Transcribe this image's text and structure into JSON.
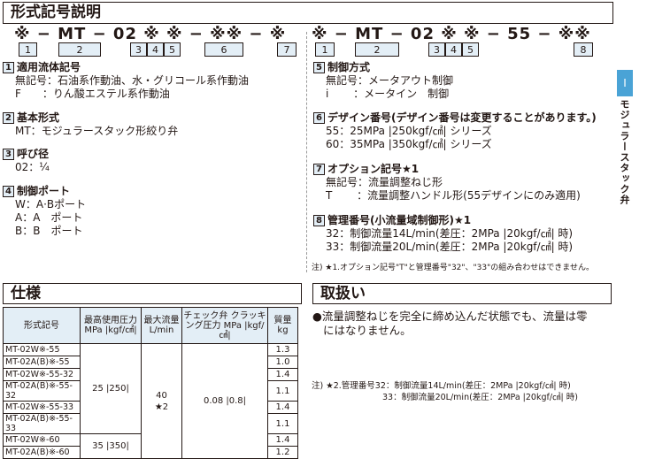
{
  "main_title": "形式記号説明",
  "code_left": {
    "text": "※ − MT − 02 ※ ※ − ※※ − ※",
    "boxes": [
      "1",
      "2",
      "3",
      "4",
      "5",
      "6",
      "7"
    ]
  },
  "code_right": {
    "text": "※ − MT − 02 ※ ※ − 55 − ※※",
    "boxes": [
      "1",
      "2",
      "3",
      "4",
      "5",
      "8"
    ]
  },
  "items_left": [
    {
      "num": "1",
      "title": "適用流体記号",
      "lines": [
        "無記号：石油系作動油、水・グリコール系作動油",
        "F　　：りん酸エステル系作動油"
      ]
    },
    {
      "num": "2",
      "title": "基本形式",
      "lines": [
        "MT：モジュラースタック形絞り弁"
      ]
    },
    {
      "num": "3",
      "title": "呼び径",
      "lines": [
        "02：¼"
      ]
    },
    {
      "num": "4",
      "title": "制御ポート",
      "lines": [
        "W：A·Bポート",
        "A：A　ポート",
        "B：B　ポート"
      ]
    }
  ],
  "items_right": [
    {
      "num": "5",
      "title": "制御方式",
      "lines": [
        "無記号：メータアウト制御",
        "i　　 ：メータイン　制御"
      ]
    },
    {
      "num": "6",
      "title": "デザイン番号(デザイン番号は変更することがあります。)",
      "lines": [
        "55：25MPa |250kgf/㎠| シリーズ",
        "60：35MPa |350kgf/㎠| シリーズ"
      ]
    },
    {
      "num": "7",
      "title": "オプション記号★1",
      "lines": [
        "無記号：流量調整ねじ形",
        "T　　 ：流量調整ハンドル形(55デザインにのみ適用)"
      ]
    },
    {
      "num": "8",
      "title": "管理番号(小流量域制御形)★1",
      "lines": [
        "32：制御流量14L/min(差圧：2MPa |20kgf/㎠| 時)",
        "33：制御流量20L/min(差圧：2MPa |20kgf/㎠| 時)"
      ]
    }
  ],
  "note1": "注) ★1.オプション記号\"T\"と管理番号\"32\"、\"33\"の組み合わせはできません。",
  "side_tab": {
    "label": "I",
    "text": "モジュラースタック弁"
  },
  "spec_title": "仕様",
  "handling_title": "取扱い",
  "handling_text_1": "●流量調整ねじを完全に締め込んだ状態でも、流量は零",
  "handling_text_2": "にはなりません。",
  "note2_line1": "注) ★2.管理番号32：制御流量14L/min(差圧：2MPa |20kgf/㎠| 時)",
  "note2_line2": "33：制御流量20L/min(差圧：2MPa |20kgf/㎠| 時)",
  "spec_table": {
    "headers": {
      "model": "形式記号",
      "pressure": "最高使用圧力 MPa |kgf/㎠|",
      "flow": "最大流量 L/min",
      "check": "チェック弁 クラッキング圧力 MPa |kgf/㎠|",
      "mass": "質量 kg"
    },
    "rows": [
      {
        "model": "MT-02W※-55",
        "mass": "1.3"
      },
      {
        "model": "MT-02A(B)※-55",
        "mass": "1.0"
      },
      {
        "model": "MT-02W※-55-32",
        "mass": "1.4"
      },
      {
        "model": "MT-02A(B)※-55-32",
        "mass": "1.1"
      },
      {
        "model": "MT-02W※-55-33",
        "mass": "1.4"
      },
      {
        "model": "MT-02A(B)※-55-33",
        "mass": "1.1"
      },
      {
        "model": "MT-02W※-60",
        "mass": "1.4"
      },
      {
        "model": "MT-02A(B)※-60",
        "mass": "1.2"
      }
    ],
    "pressure_55": "25 |250|",
    "pressure_60": "35 |350|",
    "flow_value": "40",
    "flow_note": "★2",
    "check_value": "0.08 |0.8|"
  }
}
